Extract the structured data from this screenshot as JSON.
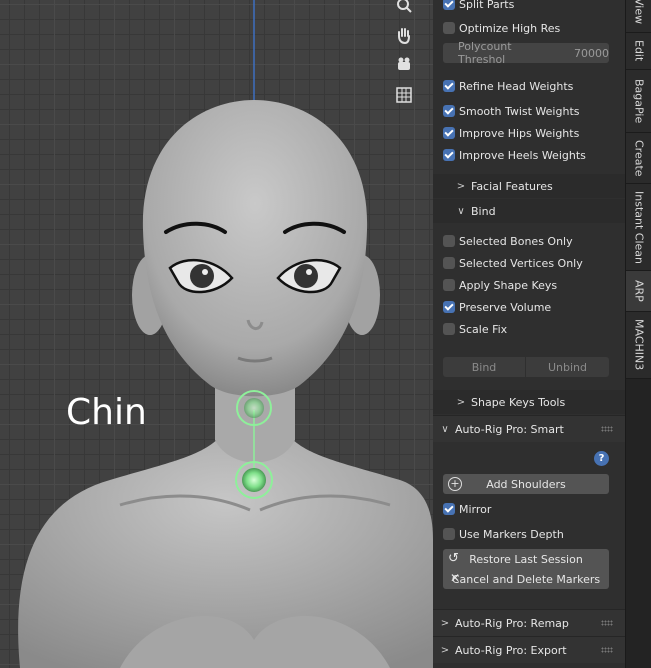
{
  "viewport": {
    "label": "Chin",
    "tools": [
      "zoom-icon",
      "hand-icon",
      "camera-icon",
      "grid-icon"
    ]
  },
  "panel": {
    "options_top": [
      {
        "label": "Split Parts",
        "checked": true
      },
      {
        "label": "Optimize High Res",
        "checked": false
      }
    ],
    "polycount": {
      "label": "Polycount Threshol",
      "value": "70000"
    },
    "options_weights": [
      {
        "label": "Refine Head Weights",
        "checked": true
      },
      {
        "label": "Smooth Twist Weights",
        "checked": true
      },
      {
        "label": "Improve Hips Weights",
        "checked": true
      },
      {
        "label": "Improve Heels Weights",
        "checked": true
      }
    ],
    "facial_features": "Facial Features",
    "bind_section": "Bind",
    "bind_options": [
      {
        "label": "Selected Bones Only",
        "checked": false
      },
      {
        "label": "Selected Vertices Only",
        "checked": false
      },
      {
        "label": "Apply Shape Keys",
        "checked": false
      },
      {
        "label": "Preserve Volume",
        "checked": true
      },
      {
        "label": "Scale Fix",
        "checked": false
      }
    ],
    "bind_button": "Bind",
    "unbind_button": "Unbind",
    "shape_keys_tools": "Shape Keys Tools",
    "smart_panel": "Auto-Rig Pro: Smart",
    "add_shoulders": "Add Shoulders",
    "mirror": {
      "label": "Mirror",
      "checked": true
    },
    "use_markers_depth": {
      "label": "Use Markers Depth",
      "checked": false
    },
    "restore_last_session": "Restore Last Session",
    "cancel_delete": "Cancel and Delete Markers",
    "remap_panel": "Auto-Rig Pro: Remap",
    "export_panel": "Auto-Rig Pro: Export"
  },
  "tabs": [
    "View",
    "Edit",
    "BagaPie",
    "Create",
    "Instant Clean",
    "ARP",
    "MACHIN3"
  ],
  "active_tab": "ARP",
  "colors": {
    "accent": "#4772b3",
    "marker": "#7fe08a"
  }
}
